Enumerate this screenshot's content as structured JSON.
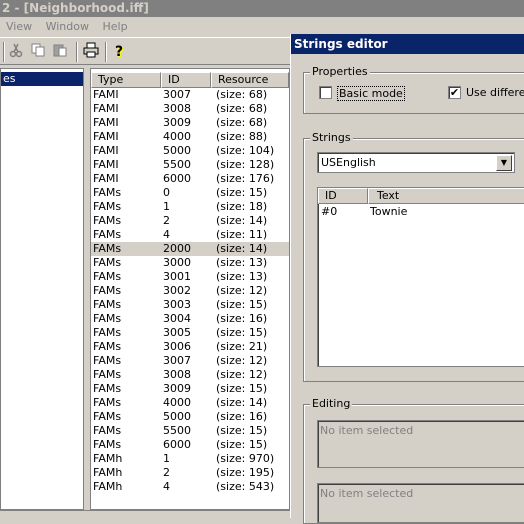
{
  "window": {
    "title": "2 - [Neighborhood.iff]"
  },
  "menu": [
    {
      "label": "View"
    },
    {
      "label": "Window"
    },
    {
      "label": "Help"
    }
  ],
  "toolbar": {
    "icons": [
      "cut-icon",
      "copy-icon",
      "paste-icon",
      "print-icon",
      "help-icon"
    ],
    "help_glyph": "?"
  },
  "tree": {
    "selected_label": "es"
  },
  "list": {
    "columns": [
      "Type",
      "ID",
      "Resource"
    ],
    "rows": [
      {
        "type": "FAMI",
        "id": "3007",
        "res": "(size: 68)"
      },
      {
        "type": "FAMI",
        "id": "3008",
        "res": "(size: 68)"
      },
      {
        "type": "FAMI",
        "id": "3009",
        "res": "(size: 68)"
      },
      {
        "type": "FAMI",
        "id": "4000",
        "res": "(size: 88)"
      },
      {
        "type": "FAMI",
        "id": "5000",
        "res": "(size: 104)"
      },
      {
        "type": "FAMI",
        "id": "5500",
        "res": "(size: 128)"
      },
      {
        "type": "FAMI",
        "id": "6000",
        "res": "(size: 176)"
      },
      {
        "type": "FAMs",
        "id": "0",
        "res": "(size: 15)"
      },
      {
        "type": "FAMs",
        "id": "1",
        "res": "(size: 18)"
      },
      {
        "type": "FAMs",
        "id": "2",
        "res": "(size: 14)"
      },
      {
        "type": "FAMs",
        "id": "4",
        "res": "(size: 11)"
      },
      {
        "type": "FAMs",
        "id": "2000",
        "res": "(size: 14)",
        "selected": true
      },
      {
        "type": "FAMs",
        "id": "3000",
        "res": "(size: 13)"
      },
      {
        "type": "FAMs",
        "id": "3001",
        "res": "(size: 13)"
      },
      {
        "type": "FAMs",
        "id": "3002",
        "res": "(size: 12)"
      },
      {
        "type": "FAMs",
        "id": "3003",
        "res": "(size: 15)"
      },
      {
        "type": "FAMs",
        "id": "3004",
        "res": "(size: 16)"
      },
      {
        "type": "FAMs",
        "id": "3005",
        "res": "(size: 15)"
      },
      {
        "type": "FAMs",
        "id": "3006",
        "res": "(size: 21)"
      },
      {
        "type": "FAMs",
        "id": "3007",
        "res": "(size: 12)"
      },
      {
        "type": "FAMs",
        "id": "3008",
        "res": "(size: 12)"
      },
      {
        "type": "FAMs",
        "id": "3009",
        "res": "(size: 15)"
      },
      {
        "type": "FAMs",
        "id": "4000",
        "res": "(size: 14)"
      },
      {
        "type": "FAMs",
        "id": "5000",
        "res": "(size: 16)"
      },
      {
        "type": "FAMs",
        "id": "5500",
        "res": "(size: 15)"
      },
      {
        "type": "FAMs",
        "id": "6000",
        "res": "(size: 15)"
      },
      {
        "type": "FAMh",
        "id": "1",
        "res": "(size: 970)"
      },
      {
        "type": "FAMh",
        "id": "2",
        "res": "(size: 195)"
      },
      {
        "type": "FAMh",
        "id": "4",
        "res": "(size: 543)"
      }
    ]
  },
  "dialog": {
    "title": "Strings editor",
    "properties_label": "Properties",
    "basic_mode_label": "Basic mode",
    "basic_mode_checked": false,
    "use_different_label": "Use different",
    "use_different_checked": true,
    "check_glyph": "✔",
    "strings_label": "Strings",
    "language": "USEnglish",
    "table_columns": [
      "ID",
      "Text"
    ],
    "table_rows": [
      {
        "id": "#0",
        "text": "Townie"
      }
    ],
    "editing_label": "Editing",
    "editing_placeholder_1": "No item selected",
    "editing_placeholder_2": "No item selected"
  }
}
